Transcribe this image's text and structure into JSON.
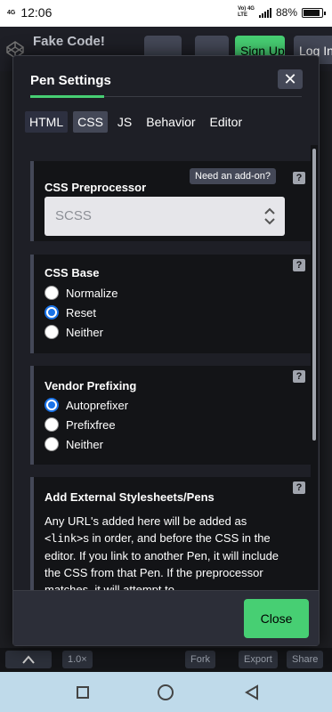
{
  "status": {
    "time": "12:06",
    "signal_small": "4G",
    "network_top": "Vo) 4G",
    "network_bottom": "LTE",
    "battery": "88%",
    "battery_level": 0.88
  },
  "background": {
    "title": "Fake Code!",
    "signup_label": "Sign Up",
    "login_label": "Log In",
    "zoom": "1.0×",
    "fork_label": "Fork",
    "export_label": "Export",
    "share_label": "Share"
  },
  "modal": {
    "title": "Pen Settings",
    "close_x": "✕",
    "tabs": [
      {
        "label": "HTML"
      },
      {
        "label": "CSS"
      },
      {
        "label": "JS"
      },
      {
        "label": "Behavior"
      },
      {
        "label": "Editor"
      }
    ],
    "preprocessor": {
      "addon_label": "Need an add-on?",
      "heading": "CSS Preprocessor",
      "value": "SCSS"
    },
    "css_base": {
      "heading": "CSS Base",
      "options": [
        "Normalize",
        "Reset",
        "Neither"
      ],
      "selected": "Reset"
    },
    "vendor_prefixing": {
      "heading": "Vendor Prefixing",
      "options": [
        "Autoprefixer",
        "Prefixfree",
        "Neither"
      ],
      "selected": "Autoprefixer"
    },
    "external": {
      "heading": "Add External Stylesheets/Pens",
      "text_1": "Any URL's added here will be added as",
      "code": "<link>",
      "text_2": "s in order, and before the CSS in the editor. If you link to another Pen, it will include the CSS from that Pen. If the preprocessor matches, it will attempt to"
    },
    "help_glyph": "?",
    "close_label": "Close"
  }
}
